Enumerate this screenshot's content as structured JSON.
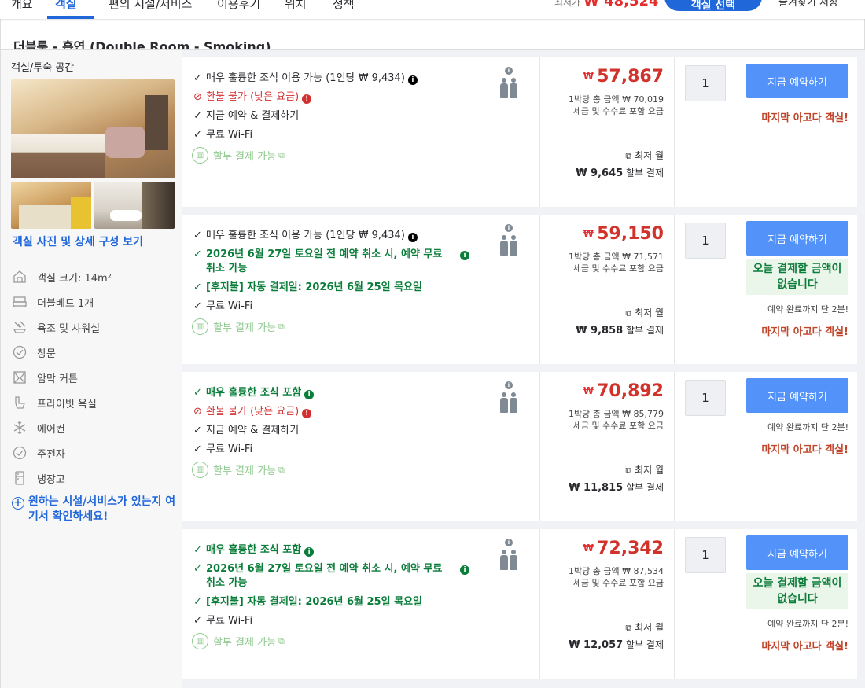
{
  "nav": {
    "tabs": [
      "개요",
      "객실",
      "편의 시설/서비스",
      "이용후기",
      "위치",
      "정책"
    ],
    "active_tab": "객실",
    "sticky_price_label": "최저가",
    "sticky_price": "₩ 48,524",
    "select_button": "객실 선택",
    "right_link": "즐겨찾기 저장"
  },
  "room": {
    "title": "더블룸 - 흡연 (Double Room - Smoking)",
    "space_label": "객실/투숙 공간",
    "photo_link": "객실 사진 및 상세 구성 보기",
    "amenities": [
      {
        "icon": "room-size-icon",
        "label": "객실 크기: 14m²"
      },
      {
        "icon": "double-bed-icon",
        "label": "더블베드 1개"
      },
      {
        "icon": "shower-icon",
        "label": "욕조 및 샤워실"
      },
      {
        "icon": "window-icon",
        "label": "창문"
      },
      {
        "icon": "blackout-curtain-icon",
        "label": "암막 커튼"
      },
      {
        "icon": "private-bathroom-icon",
        "label": "프라이빗 욕실"
      },
      {
        "icon": "air-conditioner-icon",
        "label": "에어컨"
      },
      {
        "icon": "electric-kettle-icon",
        "label": "주전자"
      },
      {
        "icon": "refrigerator-icon",
        "label": "냉장고"
      }
    ],
    "check_facilities_link": "원하는 시설/서비스가 있는지 여기서 확인하세요!"
  },
  "offers": [
    {
      "features": [
        {
          "type": "check",
          "text": "매우 훌륭한 조식 이용 가능 (1인당 ₩ 9,434)",
          "info": "black"
        },
        {
          "type": "nonrefund",
          "text": "환불 불가 (낮은 요금)",
          "info": "red"
        },
        {
          "type": "check",
          "text": "지금 예약 & 결제하기"
        },
        {
          "type": "check",
          "text": "무료 Wi-Fi"
        }
      ],
      "installment": "할부 결제 가능",
      "currency": "₩",
      "price": "57,867",
      "total_label": "1박당 총 금액 ₩ 70,019",
      "tax_label": "세금 및 수수료 포함 요금",
      "min_monthly": "최저 월",
      "installment_amount": "₩ 9,645",
      "installment_label": "할부 결제",
      "quantity": "1",
      "book_label": "지금 예약하기",
      "no_pay_today": "",
      "urgency": "",
      "last_room": "마지막 아고다 객실!"
    },
    {
      "features": [
        {
          "type": "check",
          "text": "매우 훌륭한 조식 이용 가능 (1인당 ₩ 9,434)",
          "info": "black"
        },
        {
          "type": "green",
          "text": "2026년 6월 27일 토요일 전 예약 취소 시, 예약 무료 취소 가능",
          "info": "green"
        },
        {
          "type": "green",
          "text": "[후지불] 자동 결제일: 2026년 6월 25일 목요일"
        },
        {
          "type": "check",
          "text": "무료 Wi-Fi"
        }
      ],
      "installment": "할부 결제 가능",
      "currency": "₩",
      "price": "59,150",
      "total_label": "1박당 총 금액 ₩ 71,571",
      "tax_label": "세금 및 수수료 포함 요금",
      "min_monthly": "최저 월",
      "installment_amount": "₩ 9,858",
      "installment_label": "할부 결제",
      "quantity": "1",
      "book_label": "지금 예약하기",
      "no_pay_today": "오늘 결제할 금액이 없습니다",
      "urgency": "예약 완료까지 단 2분!",
      "last_room": "마지막 아고다 객실!"
    },
    {
      "features": [
        {
          "type": "green",
          "text": "매우 훌륭한 조식 포함",
          "info": "green"
        },
        {
          "type": "nonrefund",
          "text": "환불 불가 (낮은 요금)",
          "info": "red"
        },
        {
          "type": "check",
          "text": "지금 예약 & 결제하기"
        },
        {
          "type": "check",
          "text": "무료 Wi-Fi"
        }
      ],
      "installment": "할부 결제 가능",
      "currency": "₩",
      "price": "70,892",
      "total_label": "1박당 총 금액 ₩ 85,779",
      "tax_label": "세금 및 수수료 포함 요금",
      "min_monthly": "최저 월",
      "installment_amount": "₩ 11,815",
      "installment_label": "할부 결제",
      "quantity": "1",
      "book_label": "지금 예약하기",
      "no_pay_today": "",
      "urgency": "예약 완료까지 단 2분!",
      "last_room": "마지막 아고다 객실!"
    },
    {
      "features": [
        {
          "type": "green",
          "text": "매우 훌륭한 조식 포함",
          "info": "green"
        },
        {
          "type": "green",
          "text": "2026년 6월 27일 토요일 전 예약 취소 시, 예약 무료 취소 가능",
          "info": "green"
        },
        {
          "type": "green",
          "text": "[후지불] 자동 결제일: 2026년 6월 25일 목요일"
        },
        {
          "type": "check",
          "text": "무료 Wi-Fi"
        }
      ],
      "installment": "할부 결제 가능",
      "currency": "₩",
      "price": "72,342",
      "total_label": "1박당 총 금액 ₩ 87,534",
      "tax_label": "세금 및 수수료 포함 요금",
      "min_monthly": "최저 월",
      "installment_amount": "₩ 12,057",
      "installment_label": "할부 결제",
      "quantity": "1",
      "book_label": "지금 예약하기",
      "no_pay_today": "오늘 결제할 금액이 없습니다",
      "urgency": "예약 완료까지 단 2분!",
      "last_room": "마지막 아고다 객실!"
    }
  ],
  "colors": {
    "accent": "#2067da",
    "book_button": "#5392f9",
    "price_red": "#d1322b",
    "benefit_green": "#0b7d3a",
    "last_room_orange": "#c0452b"
  }
}
